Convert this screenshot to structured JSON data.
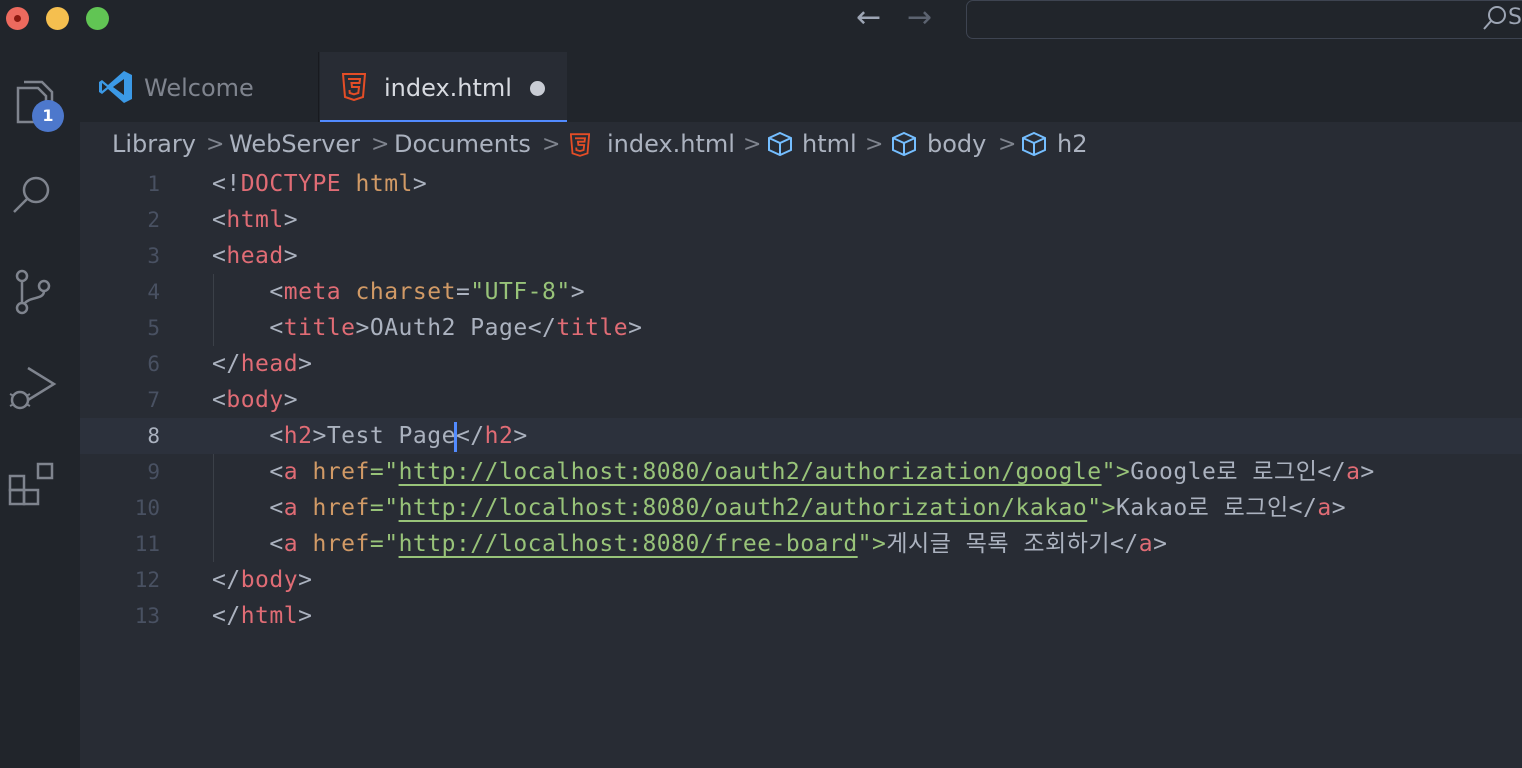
{
  "window": {
    "back_arrow": "←",
    "forward_arrow": "→",
    "search_partial": "S"
  },
  "activity_bar": {
    "explorer_badge": "1"
  },
  "tabs": [
    {
      "label": "Welcome",
      "icon": "vscode-logo-icon",
      "active": false
    },
    {
      "label": "index.html",
      "icon": "html5-icon",
      "active": true,
      "modified": true
    }
  ],
  "breadcrumb": {
    "items": [
      "Library",
      "WebServer",
      "Documents",
      "index.html",
      "html",
      "body",
      "h2"
    ],
    "separator": ">"
  },
  "editor": {
    "current_line": 8,
    "line_numbers": [
      "1",
      "2",
      "3",
      "4",
      "5",
      "6",
      "7",
      "8",
      "9",
      "10",
      "11",
      "12",
      "13"
    ],
    "lines": {
      "l1": {
        "p1": "<!",
        "tag": "DOCTYPE",
        "p2": " ",
        "attr": "html",
        "p3": ">"
      },
      "l2": {
        "p1": "<",
        "tag": "html",
        "p2": ">"
      },
      "l3": {
        "p1": "<",
        "tag": "head",
        "p2": ">"
      },
      "l4": {
        "indent": "    ",
        "p1": "<",
        "tag": "meta",
        "sp": " ",
        "attr": "charset",
        "eq": "=",
        "val": "\"UTF-8\"",
        "p2": ">"
      },
      "l5": {
        "indent": "    ",
        "p1": "<",
        "tag": "title",
        "p2": ">",
        "text": "OAuth2 Page",
        "p3": "</",
        "tag2": "title",
        "p4": ">"
      },
      "l6": {
        "p1": "</",
        "tag": "head",
        "p2": ">"
      },
      "l7": {
        "p1": "<",
        "tag": "body",
        "p2": ">"
      },
      "l8": {
        "indent": "    ",
        "p1": "<",
        "tag": "h2",
        "p2": ">",
        "text": "Test Page",
        "p3": "</",
        "tag2": "h2",
        "p4": ">"
      },
      "l9": {
        "indent": "    ",
        "p1": "<",
        "tag": "a",
        "sp": " ",
        "attr": "href",
        "eq": "=\"",
        "url": "http://localhost:8080/oauth2/authorization/google",
        "q": "\">",
        "text": "Google로 로그인",
        "p3": "</",
        "tag2": "a",
        "p4": ">"
      },
      "l10": {
        "indent": "    ",
        "p1": "<",
        "tag": "a",
        "sp": " ",
        "attr": "href",
        "eq": "=\"",
        "url": "http://localhost:8080/oauth2/authorization/kakao",
        "q": "\">",
        "text": "Kakao로 로그인",
        "p3": "</",
        "tag2": "a",
        "p4": ">"
      },
      "l11": {
        "indent": "    ",
        "p1": "<",
        "tag": "a",
        "sp": " ",
        "attr": "href",
        "eq": "=\"",
        "url": "http://localhost:8080/free-board",
        "q": "\">",
        "text": "게시글 목록 조회하기",
        "p3": "</",
        "tag2": "a",
        "p4": ">"
      },
      "l12": {
        "p1": "</",
        "tag": "body",
        "p2": ">"
      },
      "l13": {
        "p1": "</",
        "tag": "html",
        "p2": ">"
      }
    }
  },
  "colors": {
    "background": "#282c34",
    "tag": "#e06c75",
    "attribute": "#d19a66",
    "string": "#98c379",
    "badge": "#4d78cc",
    "cursor": "#528bff"
  }
}
